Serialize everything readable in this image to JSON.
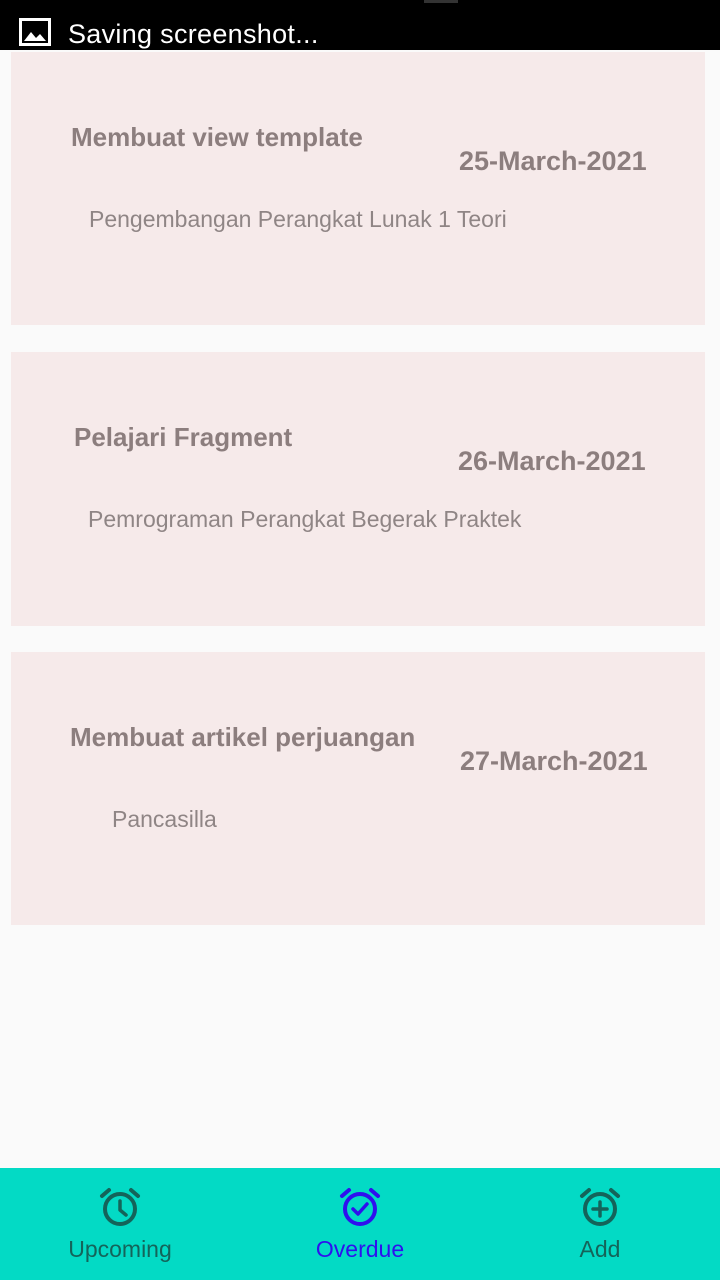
{
  "status_bar": {
    "text": "Saving screenshot..."
  },
  "cards": [
    {
      "title": "Membuat view template",
      "date": "25-March-2021",
      "subject": "Pengembangan Perangkat Lunak 1 Teori"
    },
    {
      "title": "Pelajari Fragment",
      "date": "26-March-2021",
      "subject": "Pemrograman Perangkat Begerak Praktek"
    },
    {
      "title": "Membuat artikel perjuangan",
      "date": "27-March-2021",
      "subject": "Pancasilla"
    }
  ],
  "bottom_nav": {
    "items": [
      {
        "label": "Upcoming",
        "icon": "alarm-clock-icon",
        "active": false
      },
      {
        "label": "Overdue",
        "icon": "alarm-check-icon",
        "active": true
      },
      {
        "label": "Add",
        "icon": "alarm-add-icon",
        "active": false
      }
    ]
  },
  "colors": {
    "nav_background": "#03dac5",
    "active_accent": "#2f10ee",
    "inactive_icon": "#14645a",
    "card_background": "#f6eaea"
  }
}
